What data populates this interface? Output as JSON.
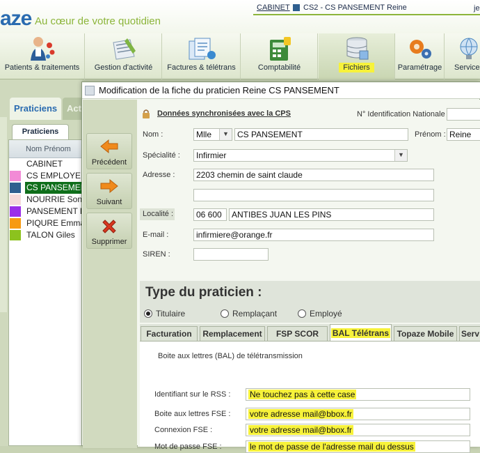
{
  "header": {
    "logo": "aze",
    "tagline": "Au cœur de votre quotidien",
    "cabinet_link": "CABINET",
    "cabinet_name": "CS2 - CS PANSEMENT Reine",
    "cabinet_extra": "je"
  },
  "toolbar": {
    "items": [
      {
        "label": "Patients & traitements",
        "icon": "patients-icon"
      },
      {
        "label": "Gestion d'activité",
        "icon": "activity-icon"
      },
      {
        "label": "Factures & télétrans",
        "icon": "invoices-icon"
      },
      {
        "label": "Comptabilité",
        "icon": "accounting-icon"
      },
      {
        "label": "Fichiers",
        "icon": "database-icon",
        "active": true
      },
      {
        "label": "Paramétrage",
        "icon": "gears-icon"
      },
      {
        "label": "Service",
        "icon": "globe-icon"
      }
    ]
  },
  "left": {
    "tab_praticiens": "Praticiens",
    "tab_act": "Act",
    "subtab": "Praticiens",
    "column_header": "Nom Prénom",
    "rows": [
      {
        "name": "CABINET",
        "color": "#ffffff"
      },
      {
        "name": "CS EMPLOYEE",
        "color": "#f28ad6"
      },
      {
        "name": "CS PANSEMENT",
        "color": "#2f5f8f",
        "selected": true
      },
      {
        "name": "NOURRIE Sonia",
        "color": "#f5dada"
      },
      {
        "name": "PANSEMENT P",
        "color": "#9b2ee8"
      },
      {
        "name": "PIQURE Emma",
        "color": "#f79a12"
      },
      {
        "name": "TALON Giles",
        "color": "#8cc21e"
      }
    ]
  },
  "dialog": {
    "title": "Modification de la fiche du praticien Reine CS PANSEMENT",
    "nav": {
      "prev": "Précédent",
      "next": "Suivant",
      "delete": "Supprimer"
    },
    "sync_label": "Données synchronisées avec la CPS",
    "nat_id_label": "N° Identification Nationale :",
    "nat_id_value": "",
    "nom_label": "Nom :",
    "civilite": "Mlle",
    "nom_value": "CS PANSEMENT",
    "prenom_label": "Prénom :",
    "prenom_value": "Reine",
    "specialite_label": "Spécialité :",
    "specialite_value": "Infirmier",
    "adresse_label": "Adresse :",
    "adresse_line1": "2203 chemin de saint claude",
    "adresse_line2": "",
    "localite_label": "Localité :",
    "cp_value": "06 600",
    "ville_value": "ANTIBES JUAN LES PINS",
    "email_label": "E-mail :",
    "email_value": "infirmiere@orange.fr",
    "siren_label": "SIREN :",
    "siren_value": "",
    "type_title": "Type du praticien :",
    "radios": [
      {
        "label": "Titulaire",
        "checked": true
      },
      {
        "label": "Remplaçant",
        "checked": false
      },
      {
        "label": "Employé",
        "checked": false
      }
    ],
    "tabs": [
      "Facturation",
      "Remplacement",
      "FSP SCOR",
      "BAL Télétrans",
      "Topaze Mobile",
      "Serv"
    ],
    "active_tab": "BAL Télétrans",
    "bal": {
      "title": "Boite aux lettres (BAL) de télétransmission",
      "rss_label": "Identifiant sur le RSS :",
      "rss_value": "Ne touchez pas à cette case",
      "bal_fse_label": "Boite aux lettres FSE :",
      "bal_fse_value": "votre adresse mail@bbox.fr",
      "conn_fse_label": "Connexion FSE :",
      "conn_fse_value": "votre adresse mail@bbox.fr",
      "pwd_fse_label": "Mot de passe FSE :",
      "pwd_fse_value": "le mot de passe de l'adresse mail du dessus"
    }
  }
}
